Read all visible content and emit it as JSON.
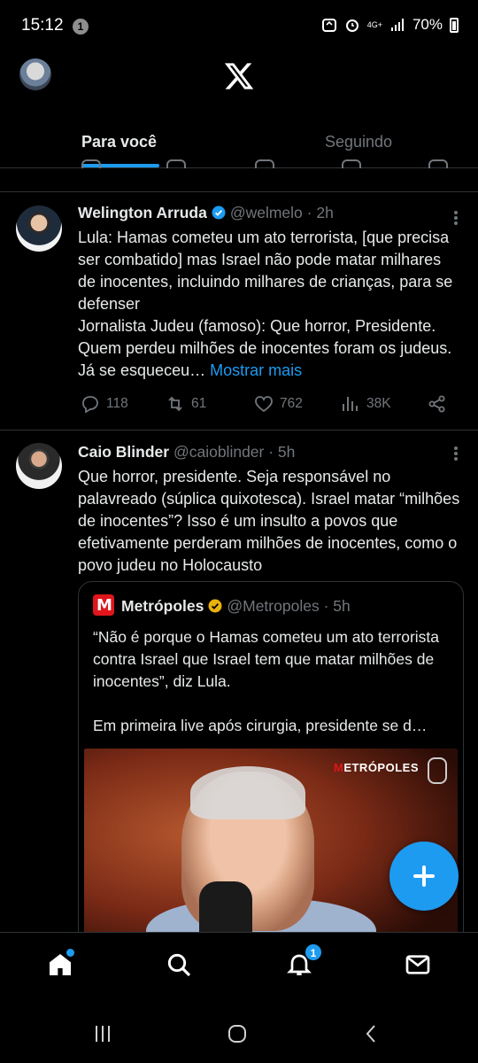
{
  "status_bar": {
    "time": "15:12",
    "notification_count": "1",
    "network": "4G+",
    "battery": "70%"
  },
  "header": {
    "logo": "x-logo-icon"
  },
  "tabs": [
    {
      "label": "Para você",
      "active": true
    },
    {
      "label": "Seguindo",
      "active": false
    }
  ],
  "tweets": [
    {
      "name": "Welington Arruda",
      "verified": true,
      "handle": "@welmelo",
      "time": "· 2h",
      "text": "Lula: Hamas cometeu um ato terrorista, [que precisa ser combatido] mas Israel não pode matar milhares de inocentes, incluindo milhares de crianças, para se defenser\nJornalista Judeu (famoso): Que horror, Presidente. Quem perdeu milhões de inocentes foram os judeus. Já se esqueceu…",
      "show_more": "Mostrar mais",
      "replies": "118",
      "retweets": "61",
      "likes": "762",
      "views": "38K"
    },
    {
      "name": "Caio Blinder",
      "verified": false,
      "handle": "@caioblinder",
      "time": "· 5h",
      "text": "Que horror, presidente. Seja responsável no palavreado (súplica quixotesca). Israel matar “milhões de inocentes”? Isso é um insulto a povos que efetivamente perderam milhões de inocentes, como o povo judeu no Holocausto",
      "quote": {
        "name": "Metrópoles",
        "handle": "@Metropoles",
        "time": "· 5h",
        "text": "“Não é porque o Hamas cometeu um ato terrorista contra Israel que Israel tem que matar milhões de inocentes”, diz Lula.\n\nEm primeira live após cirurgia, presidente se d…",
        "media_watermark": "ETRÓPOLES",
        "media_watermark_m": "M"
      }
    }
  ],
  "bottom_nav": {
    "notifications_badge": "1"
  }
}
